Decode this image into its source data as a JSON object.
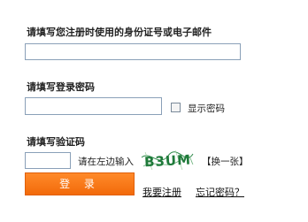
{
  "id_label": "请填写您注册时使用的身份证号或电子邮件",
  "id_input": {
    "value": "",
    "placeholder": ""
  },
  "password_label": "请填写登录密码",
  "password_input": {
    "value": "",
    "placeholder": ""
  },
  "show_password": {
    "label": "显示密码",
    "checked": false
  },
  "captcha_label": "请填写验证码",
  "captcha_input": {
    "value": "",
    "placeholder": ""
  },
  "captcha_hint": "请在左边输入",
  "captcha_image_text": "B3UM",
  "change_captcha": "【换一张】",
  "login_button": "登 录",
  "register_link": "我要注册",
  "forgot_link": "忘记密码？",
  "colors": {
    "accent": "#f26a0a",
    "input_border": "#8aa0b8"
  }
}
